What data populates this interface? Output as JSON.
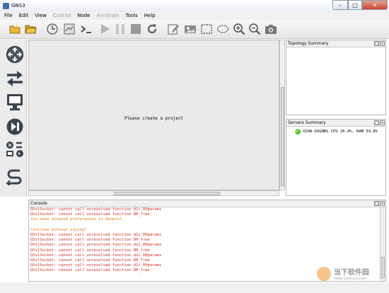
{
  "window": {
    "title": "GNS3"
  },
  "menu": {
    "items": [
      {
        "label": "File",
        "enabled": true
      },
      {
        "label": "Edit",
        "enabled": true
      },
      {
        "label": "View",
        "enabled": true
      },
      {
        "label": "Control",
        "enabled": false
      },
      {
        "label": "Node",
        "enabled": true
      },
      {
        "label": "Annotate",
        "enabled": false
      },
      {
        "label": "Tools",
        "enabled": true
      },
      {
        "label": "Help",
        "enabled": true
      }
    ]
  },
  "toolbar": {
    "icons": [
      "new-project-icon",
      "open-project-icon",
      "snapshot-icon",
      "show-interface-labels-icon",
      "console-all-icon",
      "start-all-icon",
      "suspend-all-icon",
      "stop-all-icon",
      "reload-all-icon",
      "add-note-icon",
      "insert-picture-icon",
      "draw-rectangle-icon",
      "draw-ellipse-icon",
      "zoom-in-icon",
      "zoom-out-icon",
      "screenshot-icon"
    ]
  },
  "dock": {
    "icons": [
      "routers-icon",
      "switches-icon",
      "end-devices-icon",
      "security-devices-icon",
      "all-devices-icon",
      "add-link-icon"
    ]
  },
  "canvas": {
    "message": "Please create a project"
  },
  "topology_panel": {
    "title": "Topology Summary"
  },
  "servers_panel": {
    "title": "Servers Summary",
    "server": "XIHA-OSGNBS CPU 26.4%, RAM 59.8%",
    "status_color": "#2e9a18"
  },
  "console": {
    "title": "Console",
    "lines": [
      {
        "text": "QSslSocket: cannot call unresolved function d2i_DHparams",
        "color": "#d42b1e"
      },
      {
        "text": "QSslSocket: cannot call unresolved function DH_free",
        "color": "#d42b1e"
      },
      {
        "text": "You have unsaved preferences in General.",
        "color": "#e07a10"
      },
      {
        "text": "",
        "color": ""
      },
      {
        "text": "Continue without saving?",
        "color": "#e07a10"
      },
      {
        "text": "QSslSocket: cannot call unresolved function d2i_DHparams",
        "color": "#d42b1e"
      },
      {
        "text": "QSslSocket: cannot call unresolved function DH_free",
        "color": "#d42b1e"
      },
      {
        "text": "QSslSocket: cannot call unresolved function d2i_DHparams",
        "color": "#d42b1e"
      },
      {
        "text": "QSslSocket: cannot call unresolved function DH_free",
        "color": "#d42b1e"
      },
      {
        "text": "QSslSocket: cannot call unresolved function d2i_DHparams",
        "color": "#d42b1e"
      },
      {
        "text": "QSslSocket: cannot call unresolved function DH_free",
        "color": "#d42b1e"
      },
      {
        "text": "QSslSocket: cannot call unresolved function d2i_DHparams",
        "color": "#d42b1e"
      },
      {
        "text": "QSslSocket: cannot call unresolved function DH_free",
        "color": "#d42b1e"
      }
    ]
  },
  "watermark": {
    "text_cn": "当下软件园",
    "url": "www.downxia.com"
  }
}
